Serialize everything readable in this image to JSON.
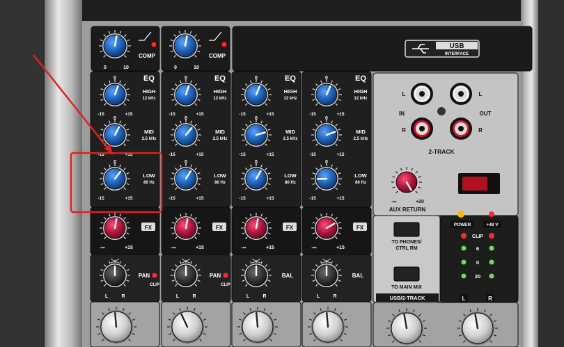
{
  "comp": {
    "label": "COMP",
    "scale_min": "0",
    "scale_max": "10"
  },
  "eq": {
    "label": "EQ",
    "high": {
      "name": "HIGH",
      "freq": "12 kHz"
    },
    "mid": {
      "name": "MID",
      "freq": "2.5 kHz"
    },
    "low": {
      "name": "LOW",
      "freq": "80 Hz"
    },
    "scale_min": "-15",
    "scale_max": "+15",
    "scale_center": "0"
  },
  "fx": {
    "label": "FX",
    "scale_min": "-∞",
    "scale_max": "+15"
  },
  "pan": {
    "label": "PAN",
    "clip": "CLIP",
    "left": "L",
    "right": "R"
  },
  "bal": {
    "label": "BAL"
  },
  "usb_badge": {
    "usb": "USB",
    "interface": "INTERFACE"
  },
  "two_track": {
    "in": "IN",
    "out": "OUT",
    "l": "L",
    "r": "R",
    "title": "2-TRACK"
  },
  "aux_return": {
    "label": "AUX RETURN",
    "scale_min": "-∞",
    "scale_max": "+20"
  },
  "power": {
    "power_label": "POWER",
    "phantom_label": "+48 V"
  },
  "meters": {
    "clip": "CLIP",
    "levels": [
      "6",
      "0",
      "20"
    ]
  },
  "routing": {
    "to_phones": "TO PHONES/",
    "ctrl_rm": "CTRL RM",
    "to_main": "TO MAIN MIX",
    "section": "USB/2-TRACK"
  },
  "main_lr": {
    "l": "L",
    "r": "R"
  },
  "colors": {
    "panel": "#1c1c1c",
    "knob_blue": "#1e63b8",
    "knob_red": "#b0153d",
    "annotation": "#e02020",
    "led_red": "#ff2a2a",
    "led_amber": "#ffb400",
    "led_green": "#6ddc5a"
  }
}
